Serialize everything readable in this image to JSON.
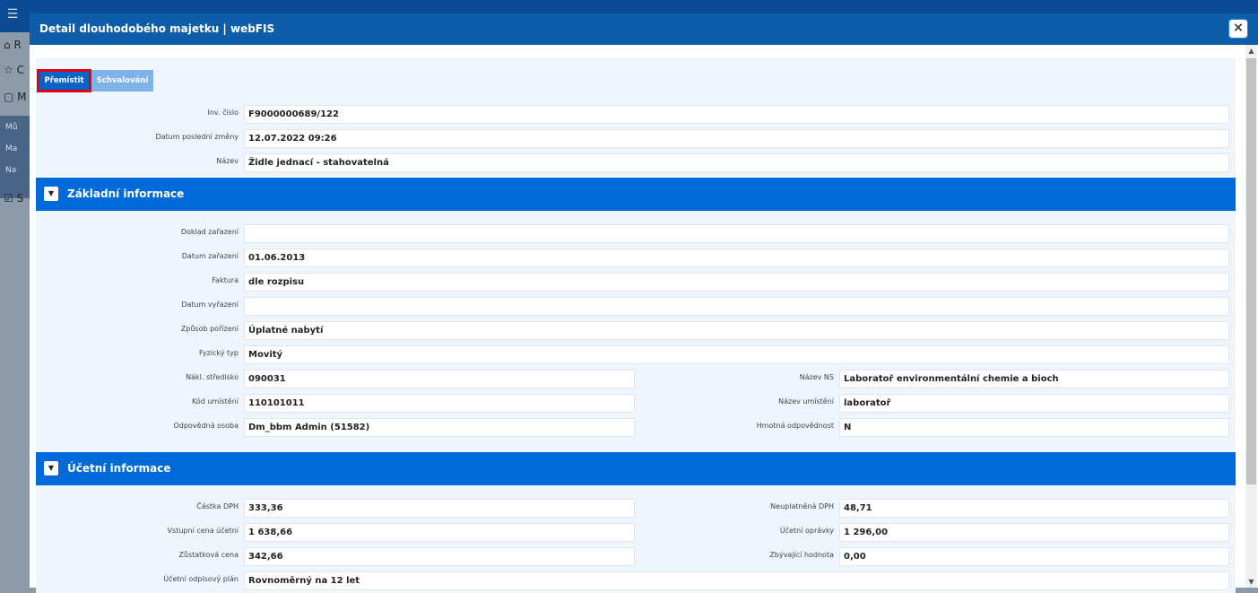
{
  "app": {
    "menu_icon": "hamburger-icon",
    "sidebar": [
      {
        "icon": "home-icon",
        "label": "R"
      },
      {
        "icon": "star-icon",
        "label": "C"
      },
      {
        "icon": "box-icon",
        "label": "M"
      },
      {
        "icon": "checkbox-icon",
        "label": "S"
      }
    ],
    "subitems": [
      "Mů",
      "Ma",
      "Na"
    ]
  },
  "modal": {
    "title": "Detail dlouhodobého majetku | webFIS",
    "close": "×",
    "buttons": {
      "move": "Přemístit",
      "approve": "Schvalování"
    },
    "top": [
      {
        "label": "Inv. číslo",
        "value": "F9000000689/122"
      },
      {
        "label": "Datum poslední změny",
        "value": "12.07.2022 09:26"
      },
      {
        "label": "Název",
        "value": "Židle jednací - stahovatelná"
      }
    ],
    "basic": {
      "title": "Základní informace",
      "full": [
        {
          "label": "Doklad zařazení",
          "value": ""
        },
        {
          "label": "Datum zařazení",
          "value": "01.06.2013"
        },
        {
          "label": "Faktura",
          "value": "dle rozpisu"
        },
        {
          "label": "Datum vyřazení",
          "value": ""
        },
        {
          "label": "Způsob pořízení",
          "value": "Úplatné nabytí"
        },
        {
          "label": "Fyzický typ",
          "value": "Movitý"
        }
      ],
      "pairs": [
        [
          {
            "label": "Nákl. středisko",
            "value": "090031"
          },
          {
            "label": "Název NS",
            "value": "Laboratoř environmentální chemie a bioch"
          }
        ],
        [
          {
            "label": "Kód umístění",
            "value": "110101011"
          },
          {
            "label": "Název umístění",
            "value": "laboratoř"
          }
        ],
        [
          {
            "label": "Odpovědná osoba",
            "value": "Dm_bbm Admin (51582)"
          },
          {
            "label": "Hmotná odpovědnost",
            "value": "N"
          }
        ]
      ]
    },
    "accounting": {
      "title": "Účetní informace",
      "pairs": [
        [
          {
            "label": "Částka DPH",
            "value": "333,36"
          },
          {
            "label": "Neuplatněná DPH",
            "value": "48,71"
          }
        ],
        [
          {
            "label": "Vstupní cena účetní",
            "value": "1 638,66"
          },
          {
            "label": "Účetní oprávky",
            "value": "1 296,00"
          }
        ],
        [
          {
            "label": "Zůstatková cena",
            "value": "342,66"
          },
          {
            "label": "Zbývající hodnota",
            "value": "0,00"
          }
        ]
      ],
      "full": [
        {
          "label": "Účetní odpisový plán",
          "value": "Rovnoměrný na 12 let"
        }
      ]
    }
  }
}
